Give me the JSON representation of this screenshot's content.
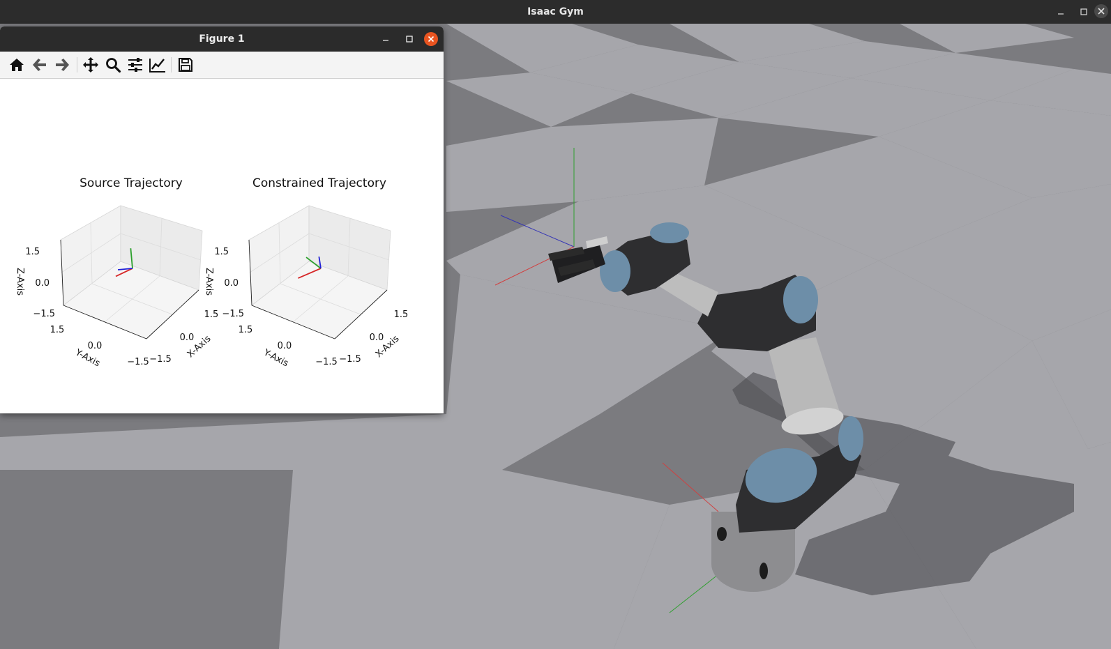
{
  "app": {
    "title": "Isaac Gym",
    "controls": [
      "minimize-icon",
      "maximize-icon",
      "close-icon"
    ]
  },
  "figure_window": {
    "title": "Figure 1",
    "controls": [
      "minimize-icon",
      "maximize-icon",
      "close-icon"
    ],
    "close_color": "#e95420",
    "toolbar": [
      {
        "icon": "home-icon",
        "tooltip": "Reset original view"
      },
      {
        "icon": "back-arrow-icon",
        "tooltip": "Back"
      },
      {
        "icon": "forward-arrow-icon",
        "tooltip": "Forward"
      },
      {
        "icon": "pan-icon",
        "tooltip": "Pan"
      },
      {
        "icon": "zoom-icon",
        "tooltip": "Zoom"
      },
      {
        "icon": "subplots-config-icon",
        "tooltip": "Configure subplots"
      },
      {
        "icon": "edit-axis-icon",
        "tooltip": "Edit axis"
      },
      {
        "icon": "save-icon",
        "tooltip": "Save the figure"
      }
    ]
  },
  "chart_data": [
    {
      "type": "scatter",
      "projection": "3d",
      "title": "Source Trajectory",
      "xlabel": "X-Axis",
      "ylabel": "Y-Axis",
      "zlabel": "Z-Axis",
      "xticks": [
        "1.5",
        "0.0",
        "−1.5"
      ],
      "yticks": [
        "1.5",
        "0.0",
        "−1.5"
      ],
      "zticks": [
        "1.5",
        "0.0",
        "−1.5"
      ],
      "xlim": [
        -1.5,
        1.5
      ],
      "ylim": [
        -1.5,
        1.5
      ],
      "zlim": [
        -1.5,
        1.5
      ],
      "grid": true,
      "series": [
        {
          "axis": "x",
          "color": "#d62728",
          "direction": [
            0.0,
            1.0,
            0.1
          ]
        },
        {
          "axis": "y",
          "color": "#2ca02c",
          "direction": [
            0.05,
            0.05,
            1.0
          ]
        },
        {
          "axis": "z",
          "color": "#1f1fd6",
          "direction": [
            0.9,
            -0.2,
            0.1
          ]
        }
      ]
    },
    {
      "type": "scatter",
      "projection": "3d",
      "title": "Constrained Trajectory",
      "xlabel": "X-Axis",
      "ylabel": "Y-Axis",
      "zlabel": "Z-Axis",
      "xticks": [
        "1.5",
        "0.0",
        "−1.5"
      ],
      "yticks": [
        "1.5",
        "0.0",
        "−1.5"
      ],
      "zticks": [
        "1.5",
        "0.0",
        "−1.5"
      ],
      "xlim": [
        -1.5,
        1.5
      ],
      "ylim": [
        -1.5,
        1.5
      ],
      "zlim": [
        -1.5,
        1.5
      ],
      "grid": true,
      "series": [
        {
          "axis": "x",
          "color": "#d62728",
          "direction": [
            0.3,
            1.0,
            0.1
          ]
        },
        {
          "axis": "y",
          "color": "#2ca02c",
          "direction": [
            0.9,
            -0.2,
            0.7
          ]
        },
        {
          "axis": "z",
          "color": "#1f1fd6",
          "direction": [
            0.05,
            0.05,
            0.6
          ]
        }
      ]
    }
  ],
  "scene": {
    "floor_light": "#a6a6ab",
    "floor_dark": "#7b7b7f",
    "robot_body": "#2e2e30",
    "robot_cap": "#6d8ea8",
    "robot_link": "#b9b9b9",
    "axis_x_color": "#d04040",
    "axis_y_color": "#2f9f2f",
    "axis_z_color": "#3535b5"
  }
}
